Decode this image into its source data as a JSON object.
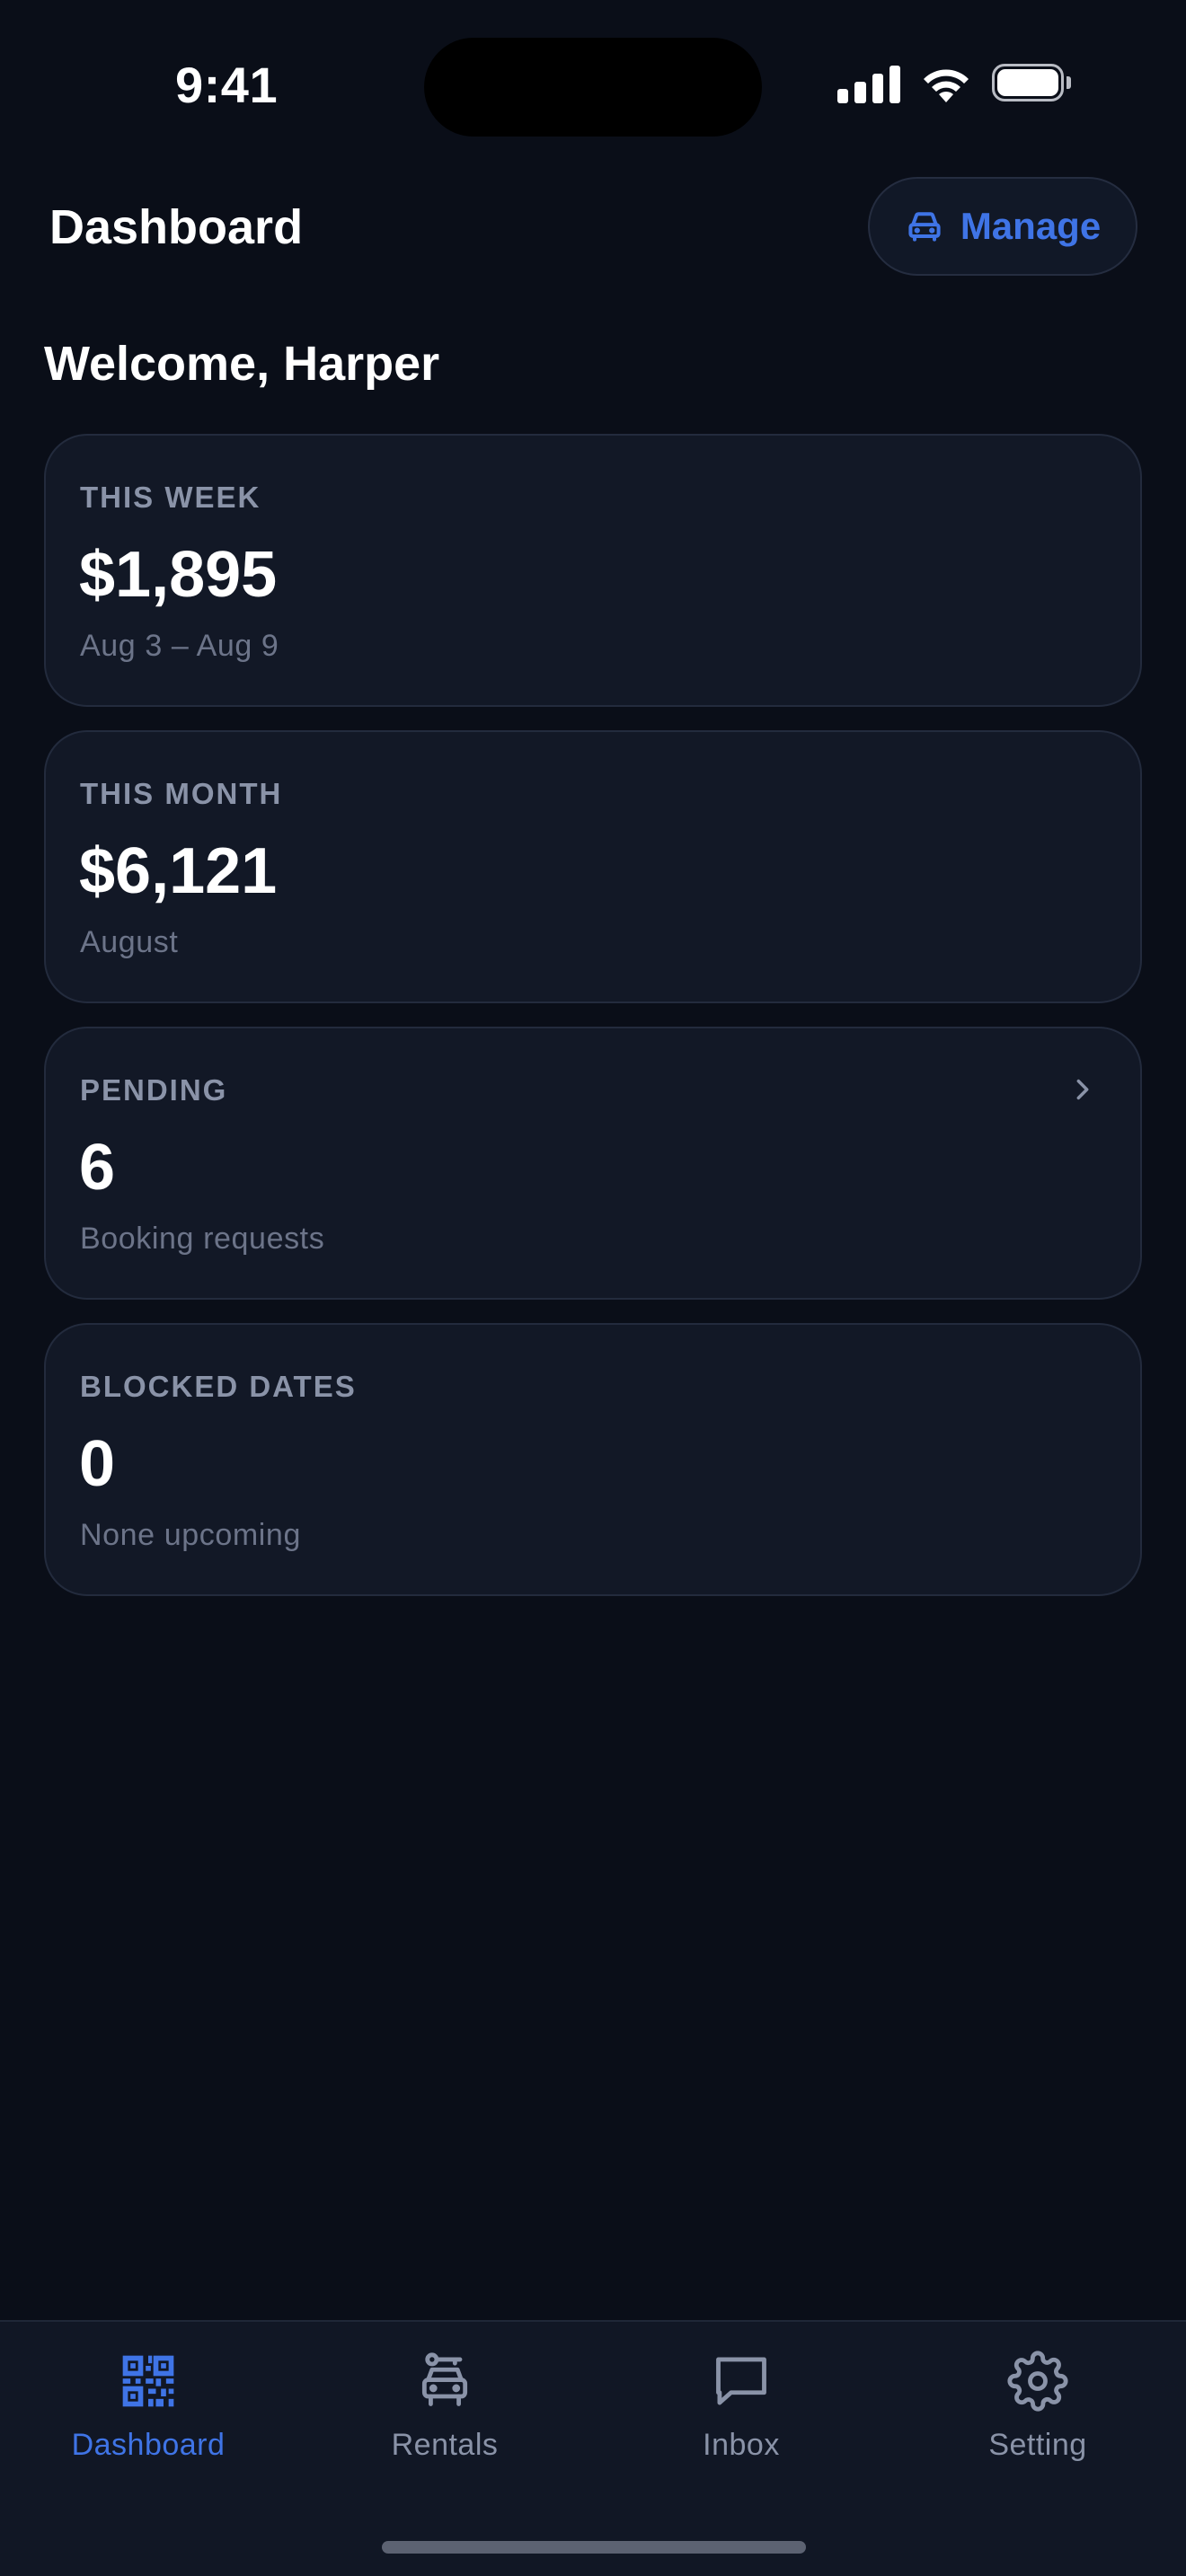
{
  "status_bar": {
    "time": "9:41"
  },
  "header": {
    "title": "Dashboard",
    "manage_label": "Manage",
    "manage_icon": "car-icon"
  },
  "welcome": "Welcome, Harper",
  "cards": [
    {
      "label": "THIS WEEK",
      "value": "$1,895",
      "sub": "Aug 3 – Aug 9"
    },
    {
      "label": "THIS MONTH",
      "value": "$6,121",
      "sub": "August"
    },
    {
      "label": "PENDING",
      "value": "6",
      "sub": "Booking requests",
      "chevron": "chevron-right-icon"
    },
    {
      "label": "BLOCKED DATES",
      "value": "0",
      "sub": "None upcoming"
    }
  ],
  "tabs": [
    {
      "label": "Dashboard",
      "icon": "qr-code-icon",
      "active": true
    },
    {
      "label": "Rentals",
      "icon": "car-key-icon",
      "active": false
    },
    {
      "label": "Inbox",
      "icon": "message-icon",
      "active": false
    },
    {
      "label": "Setting",
      "icon": "gear-icon",
      "active": false
    }
  ],
  "colors": {
    "background": "#0a0e18",
    "card": "#121826",
    "accent": "#3f74e6",
    "muted": "#8a93a8"
  }
}
